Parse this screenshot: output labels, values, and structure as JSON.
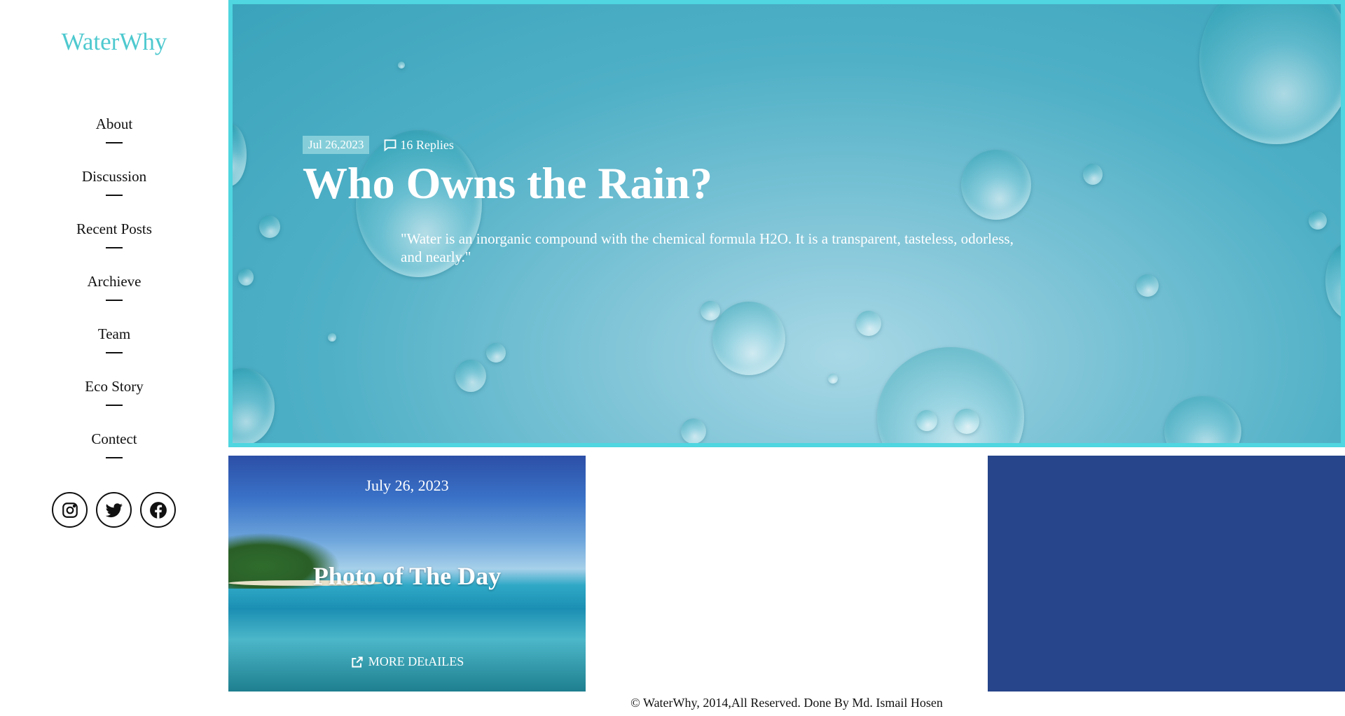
{
  "brand": {
    "name": "WaterWhy",
    "color": "#4ec9cf"
  },
  "nav": [
    {
      "label": "About"
    },
    {
      "label": "Discussion"
    },
    {
      "label": "Recent Posts"
    },
    {
      "label": "Archieve"
    },
    {
      "label": "Team"
    },
    {
      "label": "Eco Story"
    },
    {
      "label": "Contect"
    }
  ],
  "social": [
    {
      "icon": "instagram-icon"
    },
    {
      "icon": "twitter-icon"
    },
    {
      "icon": "facebook-icon"
    }
  ],
  "hero": {
    "date": "Jul 26,2023",
    "replies": "16 Replies",
    "title": "Who Owns the Rain?",
    "quote": "\"Water is an inorganic compound with the chemical formula H2O. It is a transparent, tasteless, odorless, and nearly.\"",
    "border_color": "#4fd6e0"
  },
  "photo_card": {
    "date": "July 26, 2023",
    "title": "Photo of The Day",
    "link_label": "MORE DEtAILES",
    "link_icon": "external-link-icon"
  },
  "blue_block": {
    "color": "#26458a"
  },
  "footer": {
    "text": "© WaterWhy, 2014,All Reserved. Done By Md. Ismail Hosen"
  }
}
